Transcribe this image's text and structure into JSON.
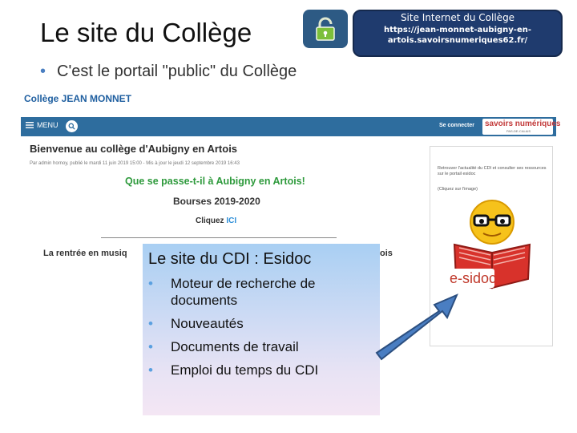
{
  "slide": {
    "title": "Le site du Collège",
    "bullet": "C'est le portail \"public\" du Collège",
    "info_box": {
      "title": "Site Internet du Collège",
      "url": "https://jean-monnet-aubigny-en-artois.savoirsnumeriques62.fr/"
    }
  },
  "website": {
    "college_name": "Collège JEAN MONNET",
    "nav": {
      "menu_label": "MENU",
      "login_label": "Se connecter",
      "logo_text": "savoirs numériques",
      "logo_subtext": "PAS-DE-CALAIS"
    },
    "main": {
      "welcome_title": "Bienvenue au collège d'Aubigny en Artois",
      "byline": "Par admin hornoy, publié le mardi 11 juin 2019 15:00 - Mis à jour le jeudi 12 septembre 2019 16:43",
      "headline": "Que se passe-t-il  à Aubigny en Artois!",
      "bourses": "Bourses 2019-2020",
      "cliquez": "Cliquez",
      "ici": "ICI",
      "rentree": "La rentrée en musiq",
      "rentree_tail": "ois"
    },
    "sidebar": {
      "text": "Retrouver l'actualité du CDI et consulter ses ressources sur le portail esidoc",
      "click_hint": "(Cliquez sur l'image)",
      "logo_text": "e-sidoc"
    }
  },
  "overlay": {
    "title": "Le site du CDI : Esidoc",
    "items": [
      "Moteur de recherche de documents",
      "Nouveautés",
      "Documents de travail",
      "Emploi du temps du CDI"
    ]
  },
  "colors": {
    "nav_blue": "#2e6d9e",
    "info_box_blue": "#1f3b6e",
    "headline_green": "#2e9a3c",
    "esidoc_red": "#c0392b",
    "arrow_blue": "#4a7ec2"
  }
}
